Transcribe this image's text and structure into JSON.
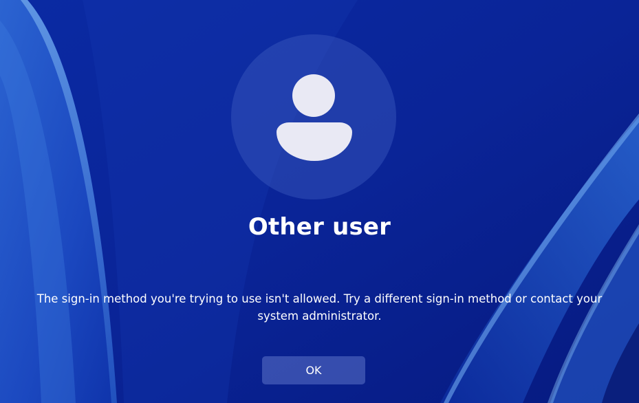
{
  "colors": {
    "background_deep": "#071a8a",
    "background_mid": "#0a2aa8",
    "ribbon_light": "#5f9be8",
    "avatar_glyph": "#e9e9f4",
    "text": "#ffffff"
  },
  "avatar": {
    "icon": "user-avatar-icon"
  },
  "user": {
    "name": "Other user"
  },
  "message": {
    "text": "The sign-in method you're trying to use isn't allowed. Try a different sign-in method or contact your system administrator."
  },
  "actions": {
    "ok_label": "OK"
  }
}
